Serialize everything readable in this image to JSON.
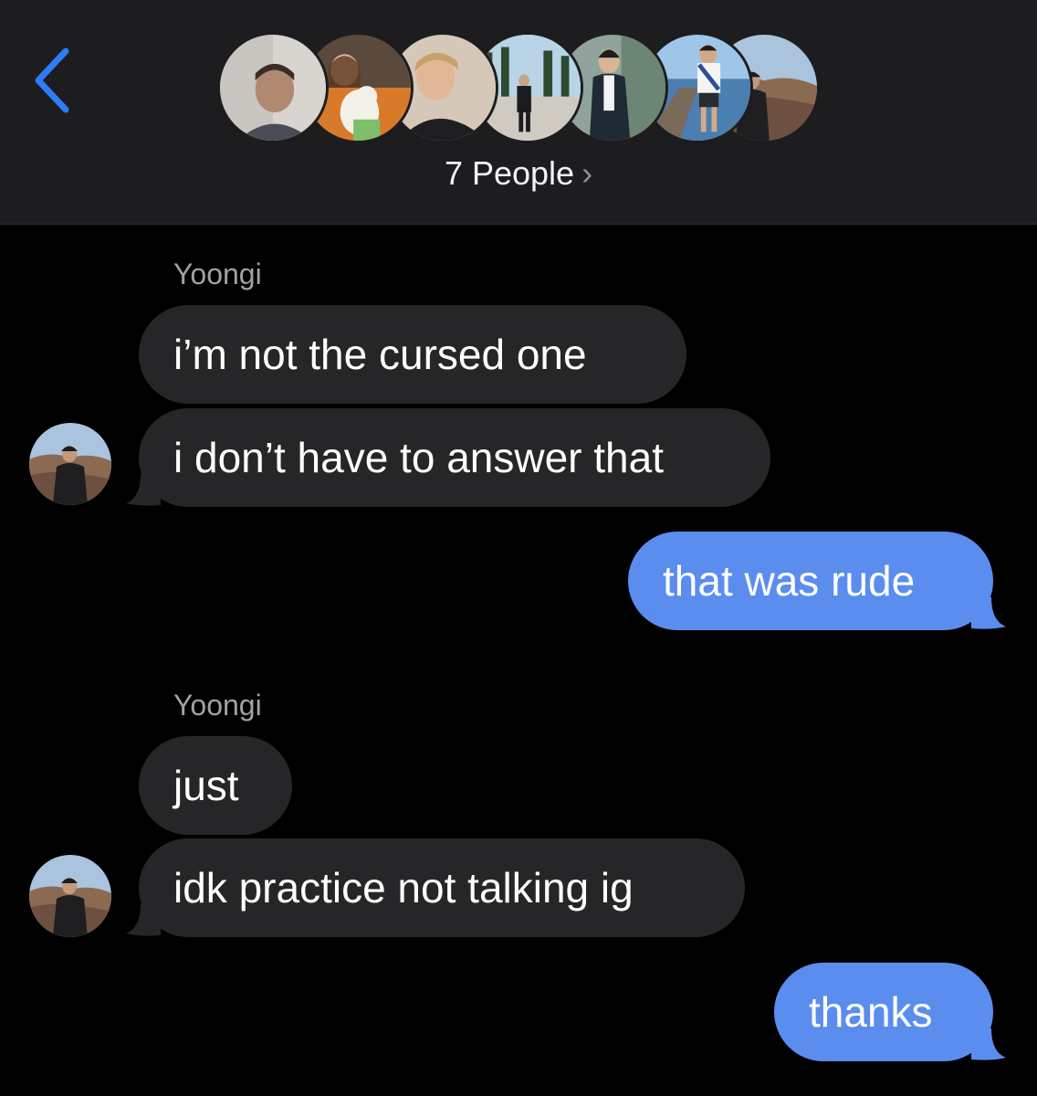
{
  "header": {
    "people_label": "7 People",
    "chevron": "›",
    "avatars": [
      "member-1",
      "member-2",
      "member-3",
      "member-4",
      "member-5",
      "member-6",
      "member-7"
    ]
  },
  "colors": {
    "header_bg": "#1d1d1f",
    "background": "#000000",
    "incoming_bubble": "#262628",
    "outgoing_bubble": "#5b8def",
    "accent": "#2f7cf6",
    "sender_name": "#a1a1a6"
  },
  "icons": {
    "back": "chevron-left-icon",
    "people_chevron": "chevron-right-icon"
  },
  "messages": [
    {
      "direction": "in",
      "sender": "Yoongi",
      "text": "i’m not the cursed one"
    },
    {
      "direction": "in",
      "text": "i don’t have to answer that"
    },
    {
      "direction": "out",
      "text": "that was rude"
    },
    {
      "direction": "in",
      "sender": "Yoongi",
      "text": "just"
    },
    {
      "direction": "in",
      "text": "idk practice not talking ig"
    },
    {
      "direction": "out",
      "text": "thanks"
    }
  ]
}
